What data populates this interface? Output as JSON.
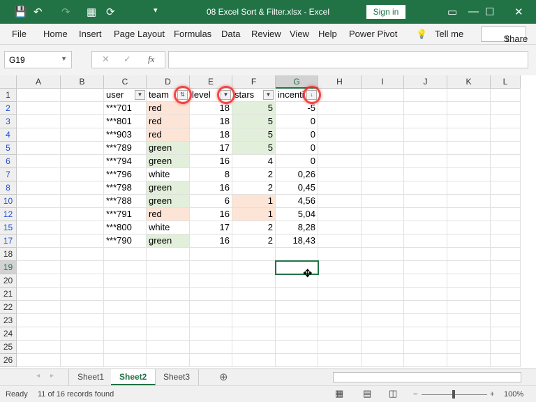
{
  "title": "08 Excel Sort & Filter.xlsx  -  Excel",
  "signin": "Sign in",
  "menu": [
    "File",
    "Home",
    "Insert",
    "Page Layout",
    "Formulas",
    "Data",
    "Review",
    "View",
    "Help",
    "Power Pivot",
    "Tell me"
  ],
  "share": "Share",
  "namebox": "G19",
  "fx": "fx",
  "columns": [
    "A",
    "B",
    "C",
    "D",
    "E",
    "F",
    "G",
    "H",
    "I",
    "J",
    "K",
    "L"
  ],
  "headers": [
    "user",
    "team",
    "level",
    "stars",
    "incenti"
  ],
  "rows": [
    {
      "n": "2",
      "user": "***701",
      "team": "red",
      "level": "18",
      "stars": "5",
      "inc": "-5"
    },
    {
      "n": "3",
      "user": "***801",
      "team": "red",
      "level": "18",
      "stars": "5",
      "inc": "0"
    },
    {
      "n": "4",
      "user": "***903",
      "team": "red",
      "level": "18",
      "stars": "5",
      "inc": "0"
    },
    {
      "n": "5",
      "user": "***789",
      "team": "green",
      "level": "17",
      "stars": "5",
      "inc": "0"
    },
    {
      "n": "6",
      "user": "***794",
      "team": "green",
      "level": "16",
      "stars": "4",
      "inc": "0"
    },
    {
      "n": "7",
      "user": "***796",
      "team": "white",
      "level": "8",
      "stars": "2",
      "inc": "0,26"
    },
    {
      "n": "8",
      "user": "***798",
      "team": "green",
      "level": "16",
      "stars": "2",
      "inc": "0,45"
    },
    {
      "n": "10",
      "user": "***788",
      "team": "green",
      "level": "6",
      "stars": "1",
      "inc": "4,56"
    },
    {
      "n": "12",
      "user": "***791",
      "team": "red",
      "level": "16",
      "stars": "1",
      "inc": "5,04"
    },
    {
      "n": "15",
      "user": "***800",
      "team": "white",
      "level": "17",
      "stars": "2",
      "inc": "8,28"
    },
    {
      "n": "17",
      "user": "***790",
      "team": "green",
      "level": "16",
      "stars": "2",
      "inc": "18,43"
    }
  ],
  "empty_rows": [
    "18",
    "19",
    "20",
    "21",
    "22",
    "23",
    "24",
    "25",
    "26"
  ],
  "colors": {
    "red": "#fce4d6",
    "green": "#e2efda",
    "accent": "#217346"
  },
  "sheets": [
    "Sheet1",
    "Sheet2",
    "Sheet3"
  ],
  "active_sheet": "Sheet2",
  "status": {
    "ready": "Ready",
    "records": "11 of 16 records found",
    "zoom": "100%"
  }
}
